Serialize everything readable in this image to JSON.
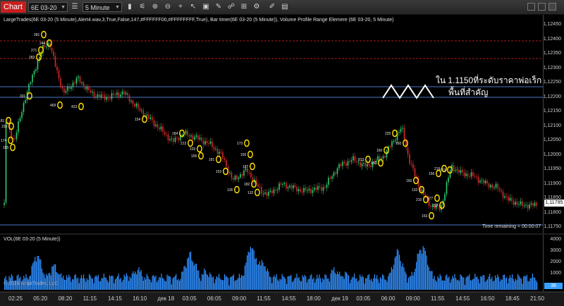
{
  "toolbar": {
    "tab_label": "Chart",
    "instrument": "6E 03-20",
    "interval": "5 Minute"
  },
  "price_panel": {
    "indicator_text": "LargeTrades(6E 03-20 (5 Minute),Alert4.wav,3,True,False,147,#FFFFFF00,#FFFFFFFF,True), Bar timer(6E 03-20 (5 Minute)), Volume Profile Range Elemere (6E 03-20, 5 Minute)",
    "price_labels": [
      "1,12450",
      "1,12400",
      "1,12350",
      "1,12300",
      "1,12250",
      "1,12200",
      "1,12150",
      "1,12100",
      "1,12050",
      "1,12000",
      "1,11950",
      "1,11900",
      "1,11850",
      "1,11800",
      "1,11750"
    ],
    "current_price": "1,11795",
    "time_remaining": "Time remaining = 00:00:07",
    "annotation_line1": "ใน 1.1150ที่ระดับราคาพ่อเร็ก",
    "annotation_line2": "พื้นที่สำคัญ",
    "large_trade_labels": [
      "281",
      "271",
      "283",
      "244",
      "331",
      "469",
      "423",
      "181",
      "155",
      "174",
      "185",
      "154",
      "184",
      "213",
      "103",
      "155",
      "181",
      "153",
      "136",
      "173",
      "150",
      "157",
      "182",
      "132",
      "213",
      "150",
      "160",
      "225",
      "150",
      "160",
      "132",
      "210",
      "153",
      "177",
      "152",
      "156",
      "219",
      "173"
    ],
    "colors": {
      "up_bar": "#2ecc71",
      "down_bar": "#d22b2b",
      "red_line": "#b01818",
      "blue_line": "#4a78c8",
      "trade_marker": "#ffe000"
    }
  },
  "volume_panel": {
    "title": "VOL(6E 03-20 (5 Minute))",
    "labels": [
      "4000",
      "3000",
      "2000",
      "1000"
    ],
    "copyright": "© 2019 NinjaTrader, LLC",
    "last_volume": "36",
    "bar_color": "#2f8fff"
  },
  "time_axis": {
    "labels": [
      "02:25",
      "05:20",
      "08:20",
      "11:15",
      "14:15",
      "16:10",
      "дек 18",
      "03:05",
      "06:05",
      "09:00",
      "11:55",
      "14:55",
      "18:00",
      "дек 19",
      "03:05",
      "06:00",
      "09:00",
      "11:55",
      "14:55",
      "16:50",
      "18:45",
      "21:50"
    ]
  }
}
